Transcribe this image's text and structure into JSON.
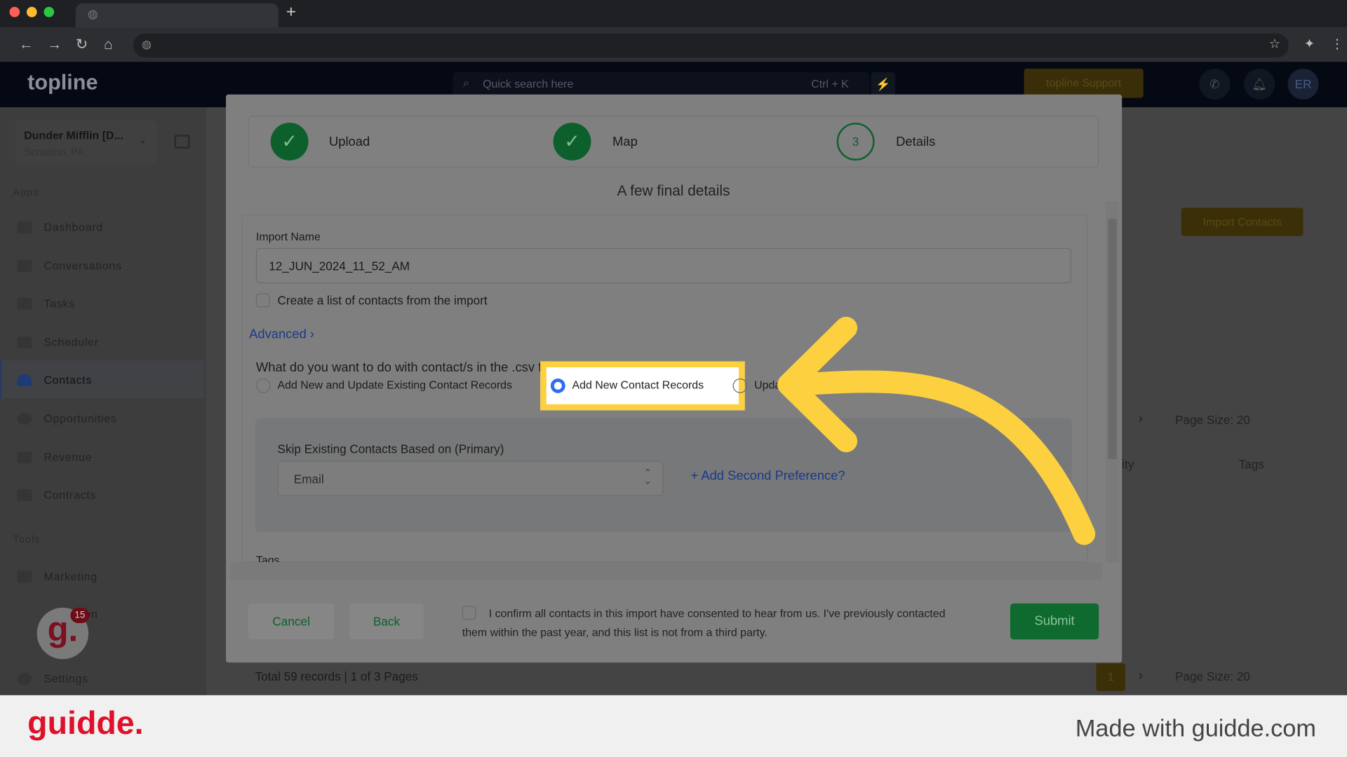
{
  "browser": {
    "new_tab": "+"
  },
  "app": {
    "logo": "topline",
    "search_placeholder": "Quick search here",
    "search_shortcut": "Ctrl + K",
    "support_label": "topline Support",
    "avatar": "ER"
  },
  "sidebar": {
    "org_name": "Dunder Mifflin [D...",
    "org_location": "Scranton, PA",
    "apps_label": "Apps",
    "tools_label": "Tools",
    "items": [
      {
        "label": "Dashboard"
      },
      {
        "label": "Conversations"
      },
      {
        "label": "Tasks"
      },
      {
        "label": "Scheduler"
      },
      {
        "label": "Contacts"
      },
      {
        "label": "Opportunities"
      },
      {
        "label": "Revenue"
      },
      {
        "label": "Contracts"
      }
    ],
    "tools": [
      {
        "label": "Marketing"
      },
      {
        "label": "...tion"
      },
      {
        "label": "Settings"
      }
    ],
    "badge": "15"
  },
  "background": {
    "import_contacts": "Import Contacts",
    "page_size": "Page Size: 20",
    "col_tags": "Tags",
    "col_city": "ity",
    "total": "Total 59 records | 1 of 3 Pages",
    "page": "1"
  },
  "modal": {
    "steps": [
      {
        "label": "Upload",
        "state": "done"
      },
      {
        "label": "Map",
        "state": "done"
      },
      {
        "label": "Details",
        "number": "3",
        "state": "current"
      }
    ],
    "title": "A few final details",
    "import_name_label": "Import Name",
    "import_name_value": "12_JUN_2024_11_52_AM",
    "create_list_label": "Create a list of contacts from the import",
    "advanced_label": "Advanced",
    "question": "What do you want to do with contact/s in the .csv file?",
    "options": [
      {
        "label": "Add New and Update Existing Contact Records",
        "selected": false
      },
      {
        "label": "Add New Contact Records",
        "selected": true
      },
      {
        "label": "Upda",
        "selected": false
      }
    ],
    "skip_label": "Skip Existing Contacts Based on (Primary)",
    "skip_value": "Email",
    "add_pref": "Add Second Preference?",
    "tags_label": "Tags",
    "cancel": "Cancel",
    "back": "Back",
    "consent": "I confirm all contacts in this import have consented to hear from us. I've previously contacted them within the past year, and this list is not from a third party.",
    "submit": "Submit"
  },
  "footer": {
    "brand": "guidde.",
    "made_with": "Made with guidde.com"
  },
  "colors": {
    "highlight": "#fdd040",
    "submit": "#0e6a2e",
    "link": "#1a3a8a",
    "brand": "#e0102a"
  }
}
